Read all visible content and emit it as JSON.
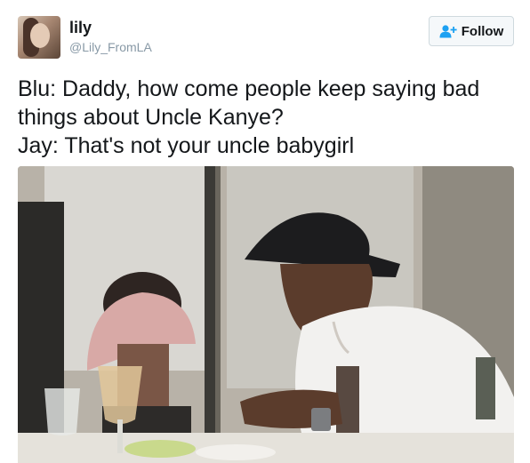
{
  "user": {
    "display_name": "lily",
    "handle": "@Lily_FromLA"
  },
  "follow_button": {
    "label": "Follow",
    "icon": "add-user-icon"
  },
  "tweet": {
    "lines": [
      "Blu: Daddy, how come people keep saying bad",
      "things about Uncle Kanye?",
      "Jay: That's not your uncle babygirl"
    ]
  },
  "colors": {
    "text": "#14171a",
    "muted": "#8899a6",
    "link_blue": "#1da1f2",
    "button_border": "#cfd9de"
  }
}
